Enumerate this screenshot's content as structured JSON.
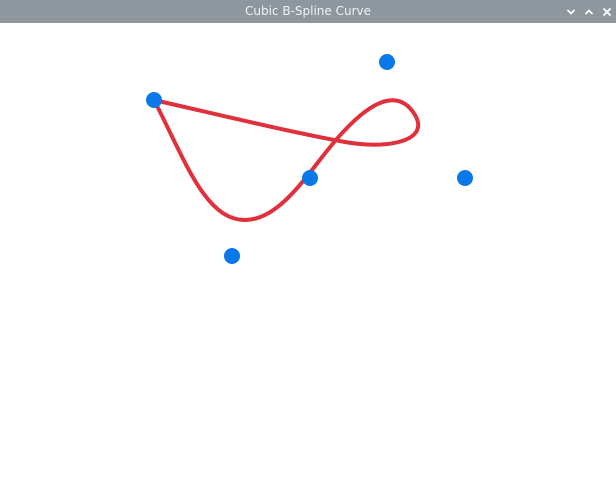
{
  "window": {
    "title": "Cubic B-Spline Curve",
    "controls": [
      "minimize-icon",
      "maximize-icon",
      "close-icon"
    ]
  },
  "colors": {
    "titlebar": "#8e969e",
    "curve": "#e0303b",
    "control_point": "#0a78e8",
    "background": "#ffffff"
  }
}
